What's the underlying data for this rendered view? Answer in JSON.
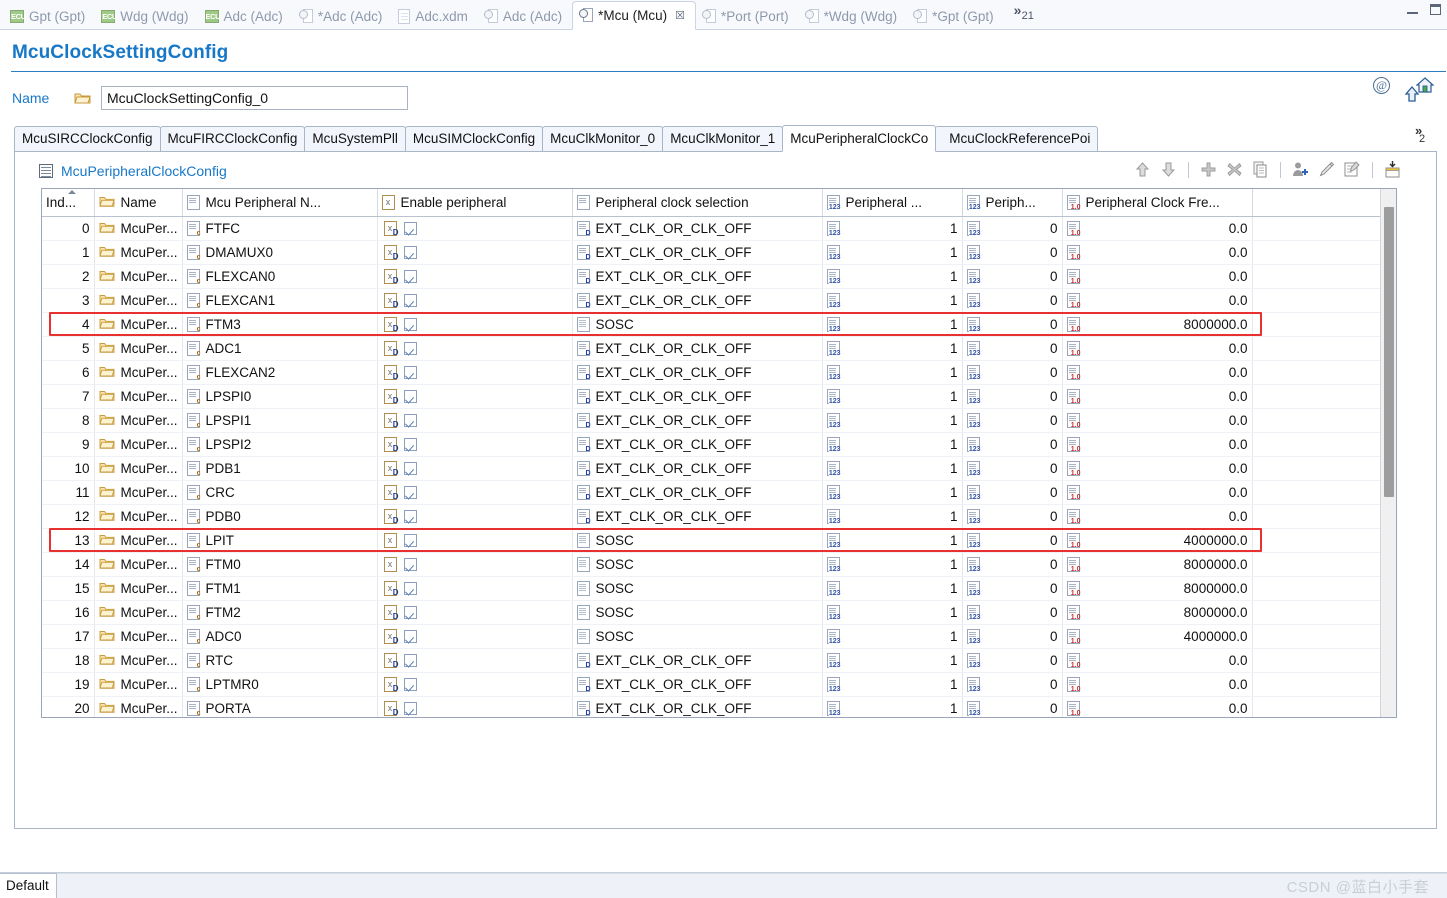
{
  "window": {
    "editor_tabs": [
      {
        "label": "Gpt (Gpt)",
        "icon": "ecu-icon",
        "active": false,
        "dirty": false
      },
      {
        "label": "Wdg (Wdg)",
        "icon": "ecu-icon",
        "active": false,
        "dirty": false
      },
      {
        "label": "Adc (Adc)",
        "icon": "ecu-icon",
        "active": false,
        "dirty": false
      },
      {
        "label": "*Adc (Adc)",
        "icon": "stamp-icon",
        "active": false,
        "dirty": true
      },
      {
        "label": "Adc.xdm",
        "icon": "doc-icon",
        "active": false,
        "dirty": false
      },
      {
        "label": "Adc (Adc)",
        "icon": "stamp-icon",
        "active": false,
        "dirty": false
      },
      {
        "label": "*Mcu (Mcu)",
        "icon": "stamp-icon",
        "active": true,
        "dirty": true
      },
      {
        "label": "*Port (Port)",
        "icon": "stamp-icon",
        "active": false,
        "dirty": true
      },
      {
        "label": "*Wdg (Wdg)",
        "icon": "stamp-icon",
        "active": false,
        "dirty": true
      },
      {
        "label": "*Gpt (Gpt)",
        "icon": "stamp-icon",
        "active": false,
        "dirty": true
      }
    ],
    "tab_overflow_chevron": "»",
    "tab_overflow_count": "21",
    "close_symbol": "☒"
  },
  "form": {
    "title": "McuClockSettingConfig",
    "header_icons": [
      "at-icon",
      "up-arrow-icon",
      "home-icon"
    ],
    "name_label": "Name",
    "name_value": "McuClockSettingConfig_0",
    "name_placeholder": "McuClockSettingConfig_0"
  },
  "inner_tabs": {
    "items": [
      {
        "label": "McuSIRCClockConfig",
        "active": false
      },
      {
        "label": "McuFIRCClockConfig",
        "active": false
      },
      {
        "label": "McuSystemPll",
        "active": false
      },
      {
        "label": "McuSIMClockConfig",
        "active": false
      },
      {
        "label": "McuClkMonitor_0",
        "active": false
      },
      {
        "label": "McuClkMonitor_1",
        "active": false
      },
      {
        "label": "McuPeripheralClockCo",
        "active": true
      },
      {
        "label": "McuClockReferencePoi",
        "active": false
      }
    ],
    "overflow_chevron": "»",
    "overflow_count": "2"
  },
  "section": {
    "title": "McuPeripheralClockConfig",
    "icon": "table-icon",
    "tools": [
      {
        "name": "move-up-icon",
        "glyph": "↑"
      },
      {
        "name": "move-down-icon",
        "glyph": "↓"
      },
      {
        "name": "add-icon",
        "glyph": "+"
      },
      {
        "name": "delete-icon",
        "glyph": "✖"
      },
      {
        "name": "copy-icon",
        "glyph": "❐"
      },
      {
        "name": "add-user-icon",
        "glyph": "☺"
      },
      {
        "name": "edit-pencil-icon",
        "glyph": "✎"
      },
      {
        "name": "edit-note-icon",
        "glyph": "✍"
      },
      {
        "name": "import-table-icon",
        "glyph": "⤓"
      }
    ]
  },
  "table": {
    "columns": [
      {
        "key": "index",
        "label": "Ind...",
        "icon": "none",
        "align": "right",
        "sorted": true
      },
      {
        "key": "name",
        "label": "Name",
        "icon": "folder-icon",
        "align": "left"
      },
      {
        "key": "mcu",
        "label": "Mcu Peripheral N...",
        "icon": "string-icon",
        "align": "left"
      },
      {
        "key": "enable",
        "label": "Enable peripheral",
        "icon": "bool-icon",
        "align": "left"
      },
      {
        "key": "sel",
        "label": "Peripheral clock selection",
        "icon": "enum-icon",
        "align": "left"
      },
      {
        "key": "div1",
        "label": "Peripheral ...",
        "icon": "int-icon",
        "align": "right"
      },
      {
        "key": "div2",
        "label": "Periph...",
        "icon": "int-icon",
        "align": "right"
      },
      {
        "key": "freq",
        "label": "Peripheral Clock Fre...",
        "icon": "float-icon",
        "align": "right"
      }
    ],
    "rows": [
      {
        "index": "0",
        "name": "McuPer...",
        "mcu": "FTFC",
        "enable": true,
        "enable_icon": "xd",
        "sel": "EXT_CLK_OR_CLK_OFF",
        "sel_icon": "enum",
        "div1": "1",
        "div2": "0",
        "freq": "0.0",
        "highlight": false
      },
      {
        "index": "1",
        "name": "McuPer...",
        "mcu": "DMAMUX0",
        "enable": true,
        "enable_icon": "xd",
        "sel": "EXT_CLK_OR_CLK_OFF",
        "sel_icon": "enum",
        "div1": "1",
        "div2": "0",
        "freq": "0.0",
        "highlight": false
      },
      {
        "index": "2",
        "name": "McuPer...",
        "mcu": "FLEXCAN0",
        "enable": true,
        "enable_icon": "xd",
        "sel": "EXT_CLK_OR_CLK_OFF",
        "sel_icon": "enum",
        "div1": "1",
        "div2": "0",
        "freq": "0.0",
        "highlight": false
      },
      {
        "index": "3",
        "name": "McuPer...",
        "mcu": "FLEXCAN1",
        "enable": true,
        "enable_icon": "xd",
        "sel": "EXT_CLK_OR_CLK_OFF",
        "sel_icon": "enum",
        "div1": "1",
        "div2": "0",
        "freq": "0.0",
        "highlight": false
      },
      {
        "index": "4",
        "name": "McuPer...",
        "mcu": "FTM3",
        "enable": true,
        "enable_icon": "xd",
        "sel": "SOSC",
        "sel_icon": "plain",
        "div1": "1",
        "div2": "0",
        "freq": "8000000.0",
        "highlight": true
      },
      {
        "index": "5",
        "name": "McuPer...",
        "mcu": "ADC1",
        "enable": true,
        "enable_icon": "xd",
        "sel": "EXT_CLK_OR_CLK_OFF",
        "sel_icon": "enum",
        "div1": "1",
        "div2": "0",
        "freq": "0.0",
        "highlight": false
      },
      {
        "index": "6",
        "name": "McuPer...",
        "mcu": "FLEXCAN2",
        "enable": true,
        "enable_icon": "xd",
        "sel": "EXT_CLK_OR_CLK_OFF",
        "sel_icon": "enum",
        "div1": "1",
        "div2": "0",
        "freq": "0.0",
        "highlight": false
      },
      {
        "index": "7",
        "name": "McuPer...",
        "mcu": "LPSPI0",
        "enable": true,
        "enable_icon": "xd",
        "sel": "EXT_CLK_OR_CLK_OFF",
        "sel_icon": "enum",
        "div1": "1",
        "div2": "0",
        "freq": "0.0",
        "highlight": false
      },
      {
        "index": "8",
        "name": "McuPer...",
        "mcu": "LPSPI1",
        "enable": true,
        "enable_icon": "xd",
        "sel": "EXT_CLK_OR_CLK_OFF",
        "sel_icon": "enum",
        "div1": "1",
        "div2": "0",
        "freq": "0.0",
        "highlight": false
      },
      {
        "index": "9",
        "name": "McuPer...",
        "mcu": "LPSPI2",
        "enable": true,
        "enable_icon": "xd",
        "sel": "EXT_CLK_OR_CLK_OFF",
        "sel_icon": "enum",
        "div1": "1",
        "div2": "0",
        "freq": "0.0",
        "highlight": false
      },
      {
        "index": "10",
        "name": "McuPer...",
        "mcu": "PDB1",
        "enable": true,
        "enable_icon": "xd",
        "sel": "EXT_CLK_OR_CLK_OFF",
        "sel_icon": "enum",
        "div1": "1",
        "div2": "0",
        "freq": "0.0",
        "highlight": false
      },
      {
        "index": "11",
        "name": "McuPer...",
        "mcu": "CRC",
        "enable": true,
        "enable_icon": "xd",
        "sel": "EXT_CLK_OR_CLK_OFF",
        "sel_icon": "enum",
        "div1": "1",
        "div2": "0",
        "freq": "0.0",
        "highlight": false
      },
      {
        "index": "12",
        "name": "McuPer...",
        "mcu": "PDB0",
        "enable": true,
        "enable_icon": "xd",
        "sel": "EXT_CLK_OR_CLK_OFF",
        "sel_icon": "enum",
        "div1": "1",
        "div2": "0",
        "freq": "0.0",
        "highlight": false
      },
      {
        "index": "13",
        "name": "McuPer...",
        "mcu": "LPIT",
        "enable": true,
        "enable_icon": "x",
        "sel": "SOSC",
        "sel_icon": "plain",
        "div1": "1",
        "div2": "0",
        "freq": "4000000.0",
        "highlight": true
      },
      {
        "index": "14",
        "name": "McuPer...",
        "mcu": "FTM0",
        "enable": true,
        "enable_icon": "x",
        "sel": "SOSC",
        "sel_icon": "plain",
        "div1": "1",
        "div2": "0",
        "freq": "8000000.0",
        "highlight": false
      },
      {
        "index": "15",
        "name": "McuPer...",
        "mcu": "FTM1",
        "enable": true,
        "enable_icon": "xd",
        "sel": "SOSC",
        "sel_icon": "plain",
        "div1": "1",
        "div2": "0",
        "freq": "8000000.0",
        "highlight": false
      },
      {
        "index": "16",
        "name": "McuPer...",
        "mcu": "FTM2",
        "enable": true,
        "enable_icon": "xd",
        "sel": "SOSC",
        "sel_icon": "plain",
        "div1": "1",
        "div2": "0",
        "freq": "8000000.0",
        "highlight": false
      },
      {
        "index": "17",
        "name": "McuPer...",
        "mcu": "ADC0",
        "enable": true,
        "enable_icon": "xd",
        "sel": "SOSC",
        "sel_icon": "plain",
        "div1": "1",
        "div2": "0",
        "freq": "4000000.0",
        "highlight": false
      },
      {
        "index": "18",
        "name": "McuPer...",
        "mcu": "RTC",
        "enable": true,
        "enable_icon": "xd",
        "sel": "EXT_CLK_OR_CLK_OFF",
        "sel_icon": "enum",
        "div1": "1",
        "div2": "0",
        "freq": "0.0",
        "highlight": false
      },
      {
        "index": "19",
        "name": "McuPer...",
        "mcu": "LPTMR0",
        "enable": true,
        "enable_icon": "xd",
        "sel": "EXT_CLK_OR_CLK_OFF",
        "sel_icon": "enum",
        "div1": "1",
        "div2": "0",
        "freq": "0.0",
        "highlight": false
      },
      {
        "index": "20",
        "name": "McuPer...",
        "mcu": "PORTA",
        "enable": true,
        "enable_icon": "xd",
        "sel": "EXT_CLK_OR_CLK_OFF",
        "sel_icon": "enum",
        "div1": "1",
        "div2": "0",
        "freq": "0.0",
        "highlight": false
      }
    ]
  },
  "bottom": {
    "tab_label": "Default",
    "watermark": "CSDN @蓝白小手套"
  },
  "colors": {
    "accent_blue": "#1878c8",
    "highlight_red": "#e83030",
    "tab_bg": "#f7f9fd"
  }
}
